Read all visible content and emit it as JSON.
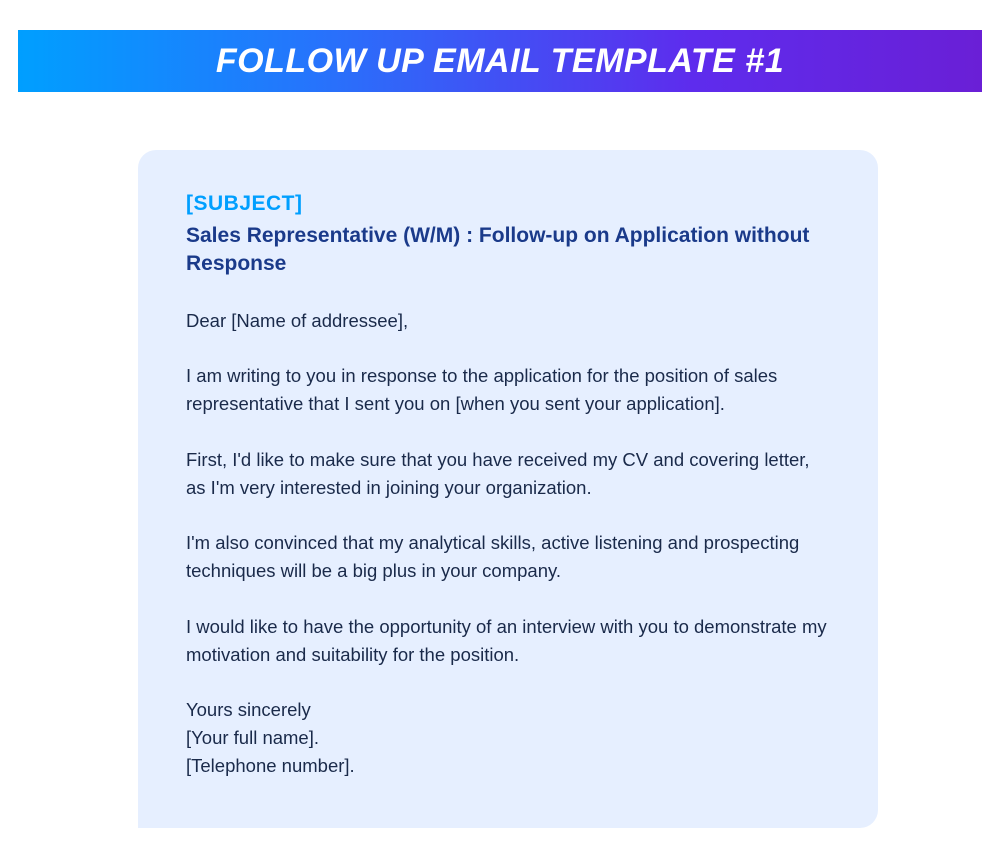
{
  "header": {
    "title": "FOLLOW UP EMAIL TEMPLATE #1"
  },
  "email": {
    "subject_label": "[SUBJECT]",
    "subject": "Sales Representative (W/M) : Follow-up on Application without Response",
    "greeting": "Dear [Name of addressee],",
    "paragraphs": [
      "I am writing to you in response to the application for the position of sales representative that I sent you on [when you sent your application].",
      "First, I'd like to make sure that you have received my CV and covering letter, as I'm very interested in joining your organization.",
      "I'm also convinced that my analytical skills, active listening and prospecting techniques will be a big plus in your company.",
      "I would like to have the opportunity of an interview with you to demonstrate my motivation and suitability for the position."
    ],
    "signoff": {
      "closing": "Yours sincerely",
      "name": "[Your full name].",
      "phone": "[Telephone number]."
    }
  }
}
